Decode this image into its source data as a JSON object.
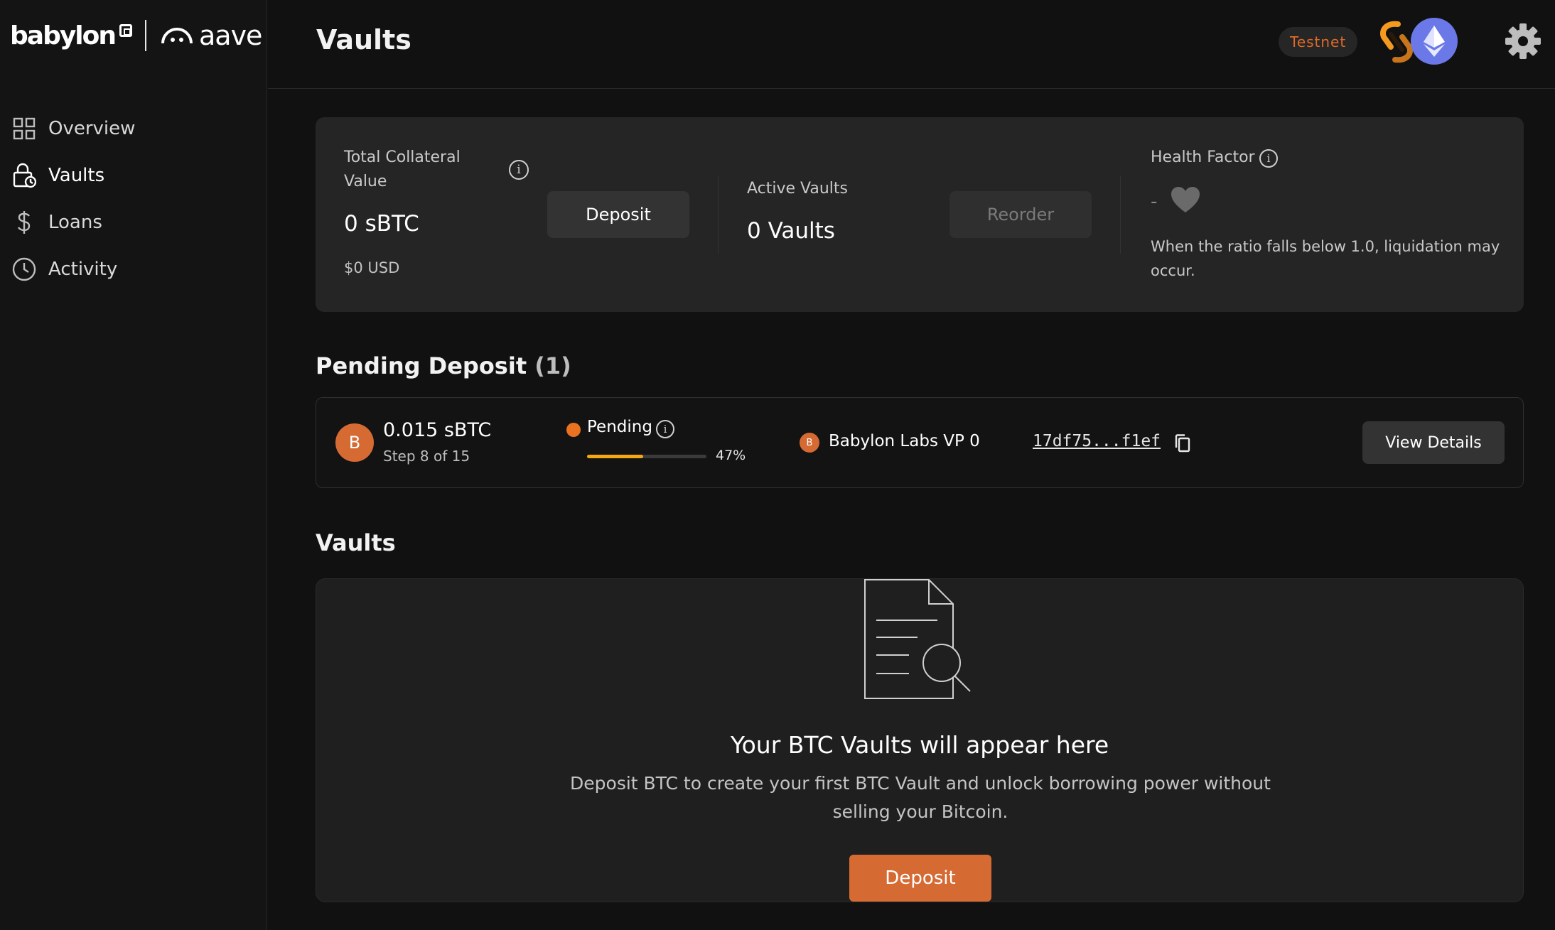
{
  "brand": {
    "logo_babylon": "babylon",
    "logo_aave": "aave"
  },
  "sidebar": {
    "items": [
      {
        "label": "Overview",
        "icon": "grid-icon",
        "active": false
      },
      {
        "label": "Vaults",
        "icon": "lock-clock-icon",
        "active": true
      },
      {
        "label": "Loans",
        "icon": "dollar-icon",
        "active": false
      },
      {
        "label": "Activity",
        "icon": "clock-icon",
        "active": false
      }
    ]
  },
  "header": {
    "title": "Vaults",
    "network_badge": "Testnet"
  },
  "summary": {
    "collateral_label": "Total Collateral Value",
    "collateral_value": "0 sBTC",
    "collateral_usd": "$0 USD",
    "deposit_label": "Deposit",
    "active_vaults_label": "Active Vaults",
    "active_vaults_value": "0 Vaults",
    "reorder_label": "Reorder",
    "health_label": "Health Factor",
    "health_value": "-",
    "health_note": "When the ratio falls below 1.0, liquidation may occur."
  },
  "pending": {
    "title": "Pending Deposit",
    "count": "(1)",
    "item": {
      "avatar_letter": "B",
      "amount": "0.015 sBTC",
      "step": "Step 8 of 15",
      "status": "Pending",
      "progress_percent": 47,
      "progress_label": "47%",
      "provider_letter": "B",
      "provider": "Babylon Labs VP 0",
      "tx_hash": "17df75...f1ef",
      "view_details_label": "View Details"
    }
  },
  "vaults": {
    "title": "Vaults",
    "empty_title": "Your BTC Vaults will appear here",
    "empty_desc": "Deposit BTC to create your first BTC Vault and unlock borrowing power without selling your Bitcoin.",
    "deposit_label": "Deposit"
  },
  "colors": {
    "background": "#111111",
    "card": "#252525",
    "accent_orange": "#d66a33",
    "pending_dot": "#ea7321",
    "progress": "#f3a712",
    "eth_avatar": "#6a78e8"
  }
}
